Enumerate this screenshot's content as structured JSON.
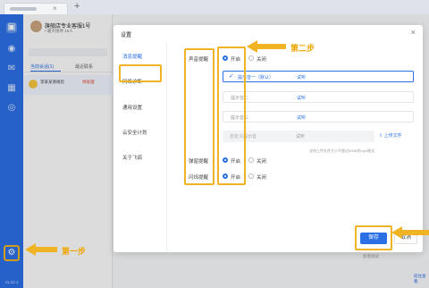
{
  "titlebar": {
    "close_glyph": "×",
    "new_tab_glyph": "+"
  },
  "nav": {
    "icons": [
      "chat-icon",
      "contacts-icon",
      "mail-icon",
      "calendar-icon",
      "workspace-icon",
      "settings-icon"
    ],
    "version": "v1.10.1"
  },
  "panel": {
    "user_name": "旗舰店专业客服1号",
    "user_status": "• 最大接待 16人",
    "tabs": [
      "当前会话(1)",
      "最近联系"
    ],
    "item_name": "李某某谢谢您",
    "item_badge": "待处理"
  },
  "background": {
    "footer_text": "新增测试",
    "footer_link": "前往查看"
  },
  "dialog": {
    "title": "设置",
    "close": "×",
    "menu": [
      "消息提醒",
      "网络诊断",
      "通用设置",
      "云安全计划",
      "关于飞鸽"
    ],
    "sound": {
      "label": "声音提醒",
      "on": "开启",
      "off": "关闭",
      "options": [
        "提示音一（默认）",
        "提示音二",
        "提示音三"
      ],
      "try_label": "试听",
      "custom_placeholder": "自定义提示音",
      "upload": "上传文件",
      "hint": "支持上传文件大小不超过500K的mp3格式"
    },
    "popup": {
      "label": "弹窗提醒",
      "on": "开启",
      "off": "关闭"
    },
    "flash": {
      "label": "闪烁提醒",
      "on": "开启",
      "off": "关闭"
    },
    "save": "保存",
    "cancel": "取消"
  },
  "annotations": {
    "step1": "第一步",
    "step2": "第二步"
  },
  "colors": {
    "primary": "#2b6fe4",
    "highlight": "#f0b323"
  }
}
